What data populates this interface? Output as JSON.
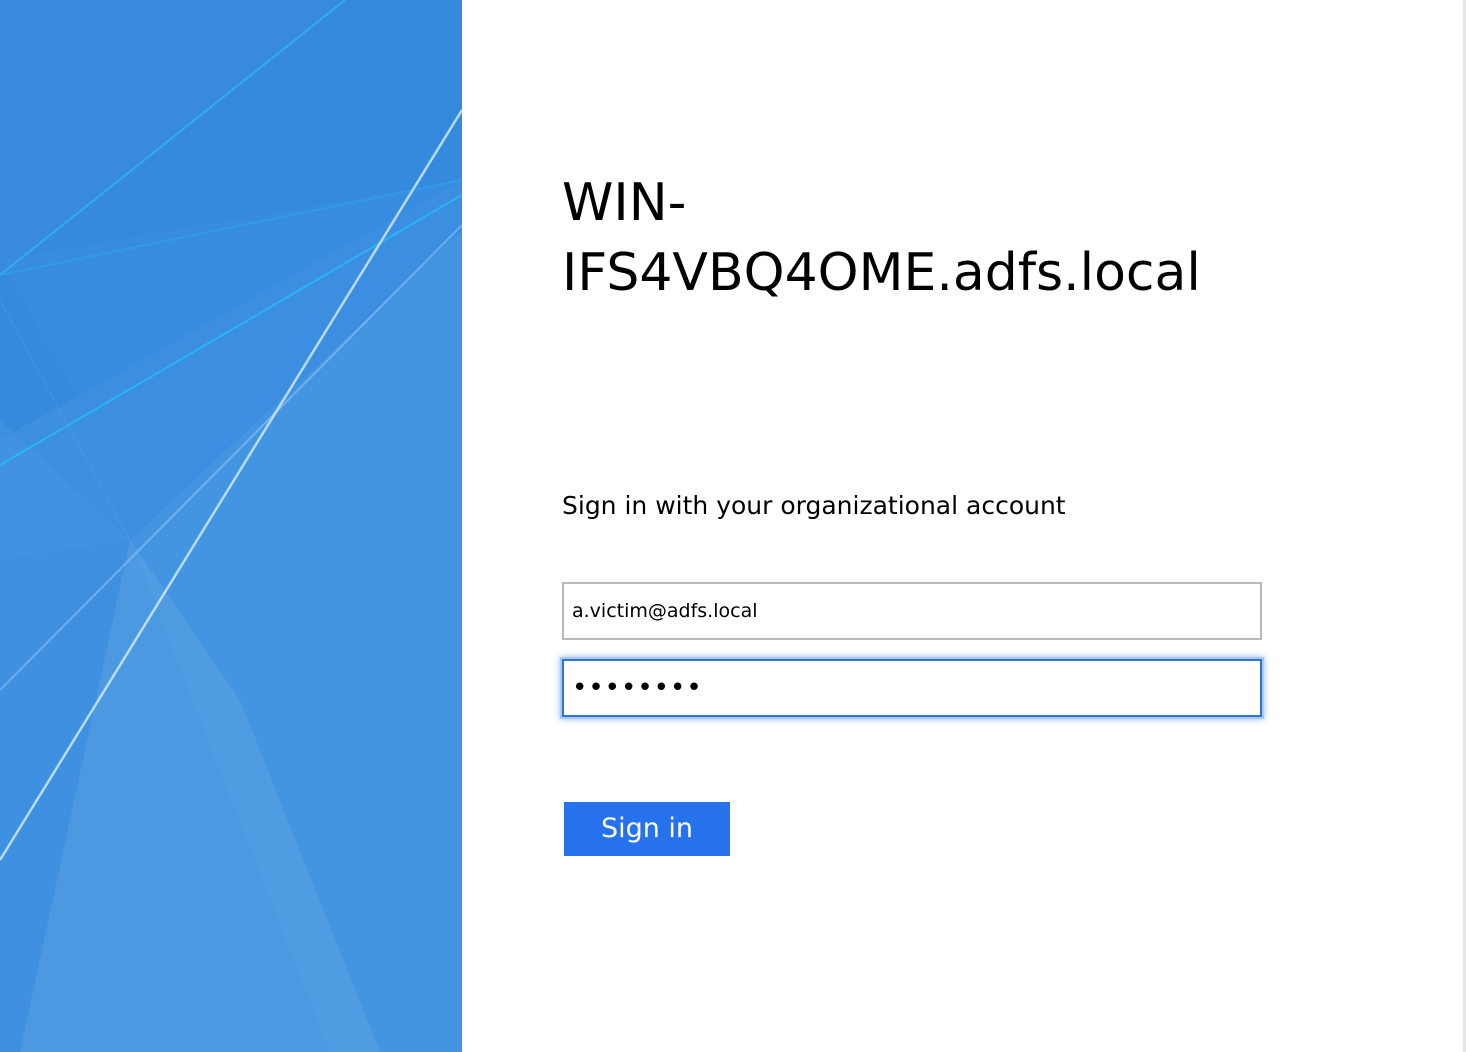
{
  "page": {
    "server_title_line1": "WIN-",
    "server_title_line2": "IFS4VBQ4OME.adfs.local",
    "prompt": "Sign in with your organizational account"
  },
  "form": {
    "username_value": "a.victim@adfs.local",
    "password_value": "••••••••",
    "sign_in_label": "Sign in"
  },
  "colors": {
    "panel_blue": "#3a8ee0",
    "button_blue": "#2672ec",
    "focus_blue": "#2f74d0"
  }
}
